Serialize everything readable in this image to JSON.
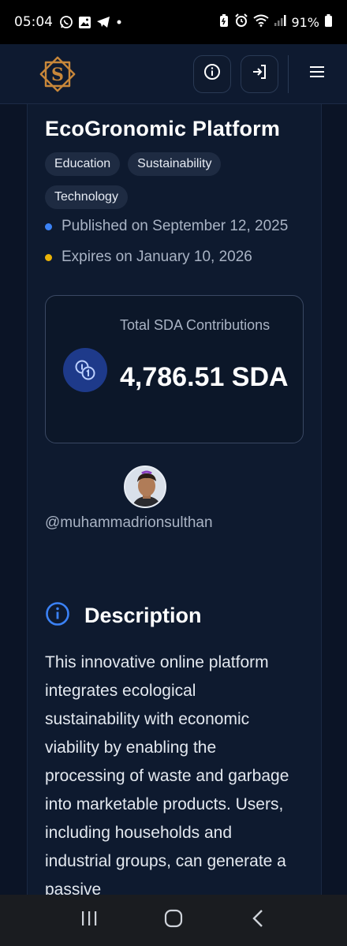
{
  "status_bar": {
    "time": "05:04",
    "battery": "91%",
    "icons": [
      "whatsapp-icon",
      "gallery-icon",
      "telegram-icon",
      "dot-icon",
      "battery-saver-icon",
      "alarm-icon",
      "wifi-icon",
      "signal-icon",
      "battery-icon"
    ]
  },
  "header": {
    "logo_icon": "brand-logo-icon",
    "buttons": [
      "info-icon",
      "login-icon",
      "menu-icon"
    ]
  },
  "project": {
    "title": "EcoGronomic Platform",
    "tags": [
      "Education",
      "Sustainability",
      "Technology"
    ],
    "published": "Published on September 12, 2025",
    "expires": "Expires on January 10, 2026",
    "published_dot_color": "#3b82f6",
    "expires_dot_color": "#eab308"
  },
  "contributions": {
    "label": "Total SDA Contributions",
    "value": "4,786.51 SDA",
    "icon": "coins-icon"
  },
  "creator": {
    "username": "@muhammadrionsulthan"
  },
  "description": {
    "heading": "Description",
    "icon": "info-circle-icon",
    "body": "This innovative online platform integrates ecological sustainability with economic viability by enabling the processing of waste and garbage into marketable products. Users, including households and industrial groups, can generate a passive"
  },
  "nav": [
    "recent-apps-icon",
    "home-icon",
    "back-icon"
  ],
  "colors": {
    "background": "#0b1426",
    "card": "#0e1a2f",
    "accent": "#3b82f6",
    "logo_gold": "#c8873a"
  }
}
